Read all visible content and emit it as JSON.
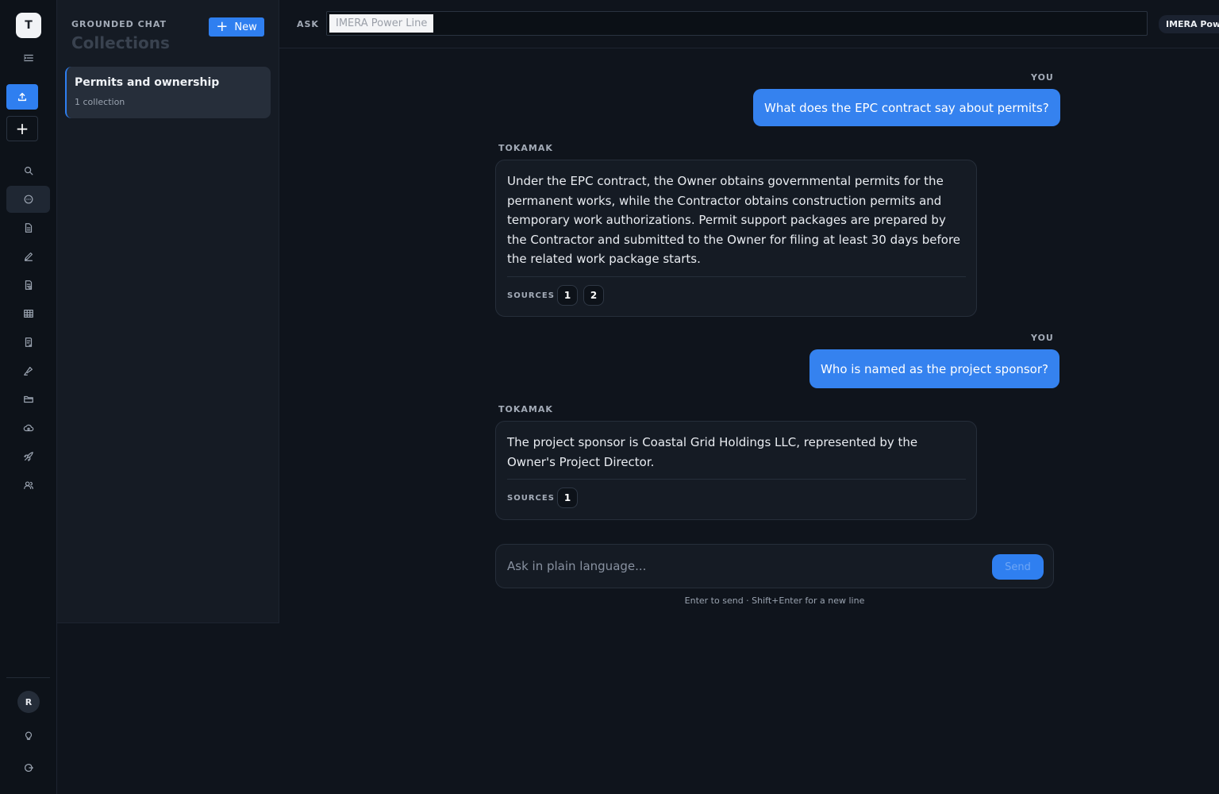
{
  "rail": {
    "workspace_initial": "T",
    "user_initial": "R",
    "items": [
      "menu-icon",
      "upload-icon",
      "plus-icon",
      "search-icon",
      "chat-icon",
      "document-icon",
      "pen-icon",
      "report-icon",
      "table-icon",
      "checklist-icon",
      "highlighter-icon",
      "folder-icon",
      "cloud-icon",
      "rocket-icon",
      "users-icon",
      "lightbulb-icon",
      "logout-icon"
    ]
  },
  "panel": {
    "eyebrow": "GROUNDED CHAT",
    "title": "Collections",
    "new_label": "New",
    "collections": [
      {
        "name": "Permits and ownership",
        "sub": "1 collection"
      }
    ]
  },
  "topbar": {
    "ask_label": "ASK",
    "ask_chip": "IMERA Power Line",
    "context_pill": "IMERA Power Line"
  },
  "chat": {
    "messages": [
      {
        "role": "YOU",
        "text": "What does the EPC contract say about permits?"
      },
      {
        "role": "TOKAMAK",
        "text": "Under the EPC contract, the Owner obtains governmental permits for the permanent works, while the Contractor obtains construction permits and temporary work authorizations. Permit support packages are prepared by the Contractor and submitted to the Owner for filing at least 30 days before the related work package starts.",
        "sources_label": "SOURCES",
        "sources": [
          "1",
          "2"
        ]
      },
      {
        "role": "YOU",
        "text": "Who is named as the project sponsor?"
      },
      {
        "role": "TOKAMAK",
        "text": "The project sponsor is Coastal Grid Holdings LLC, represented by the Owner's Project Director.",
        "sources_label": "SOURCES",
        "sources": [
          "1"
        ]
      }
    ],
    "composer_placeholder": "Ask in plain language...",
    "send_label": "Send",
    "hint": "Enter to send · Shift+Enter for a new line"
  },
  "colors": {
    "accent": "#2f7ff0",
    "background": "#0f141c",
    "panel": "#151b24"
  }
}
